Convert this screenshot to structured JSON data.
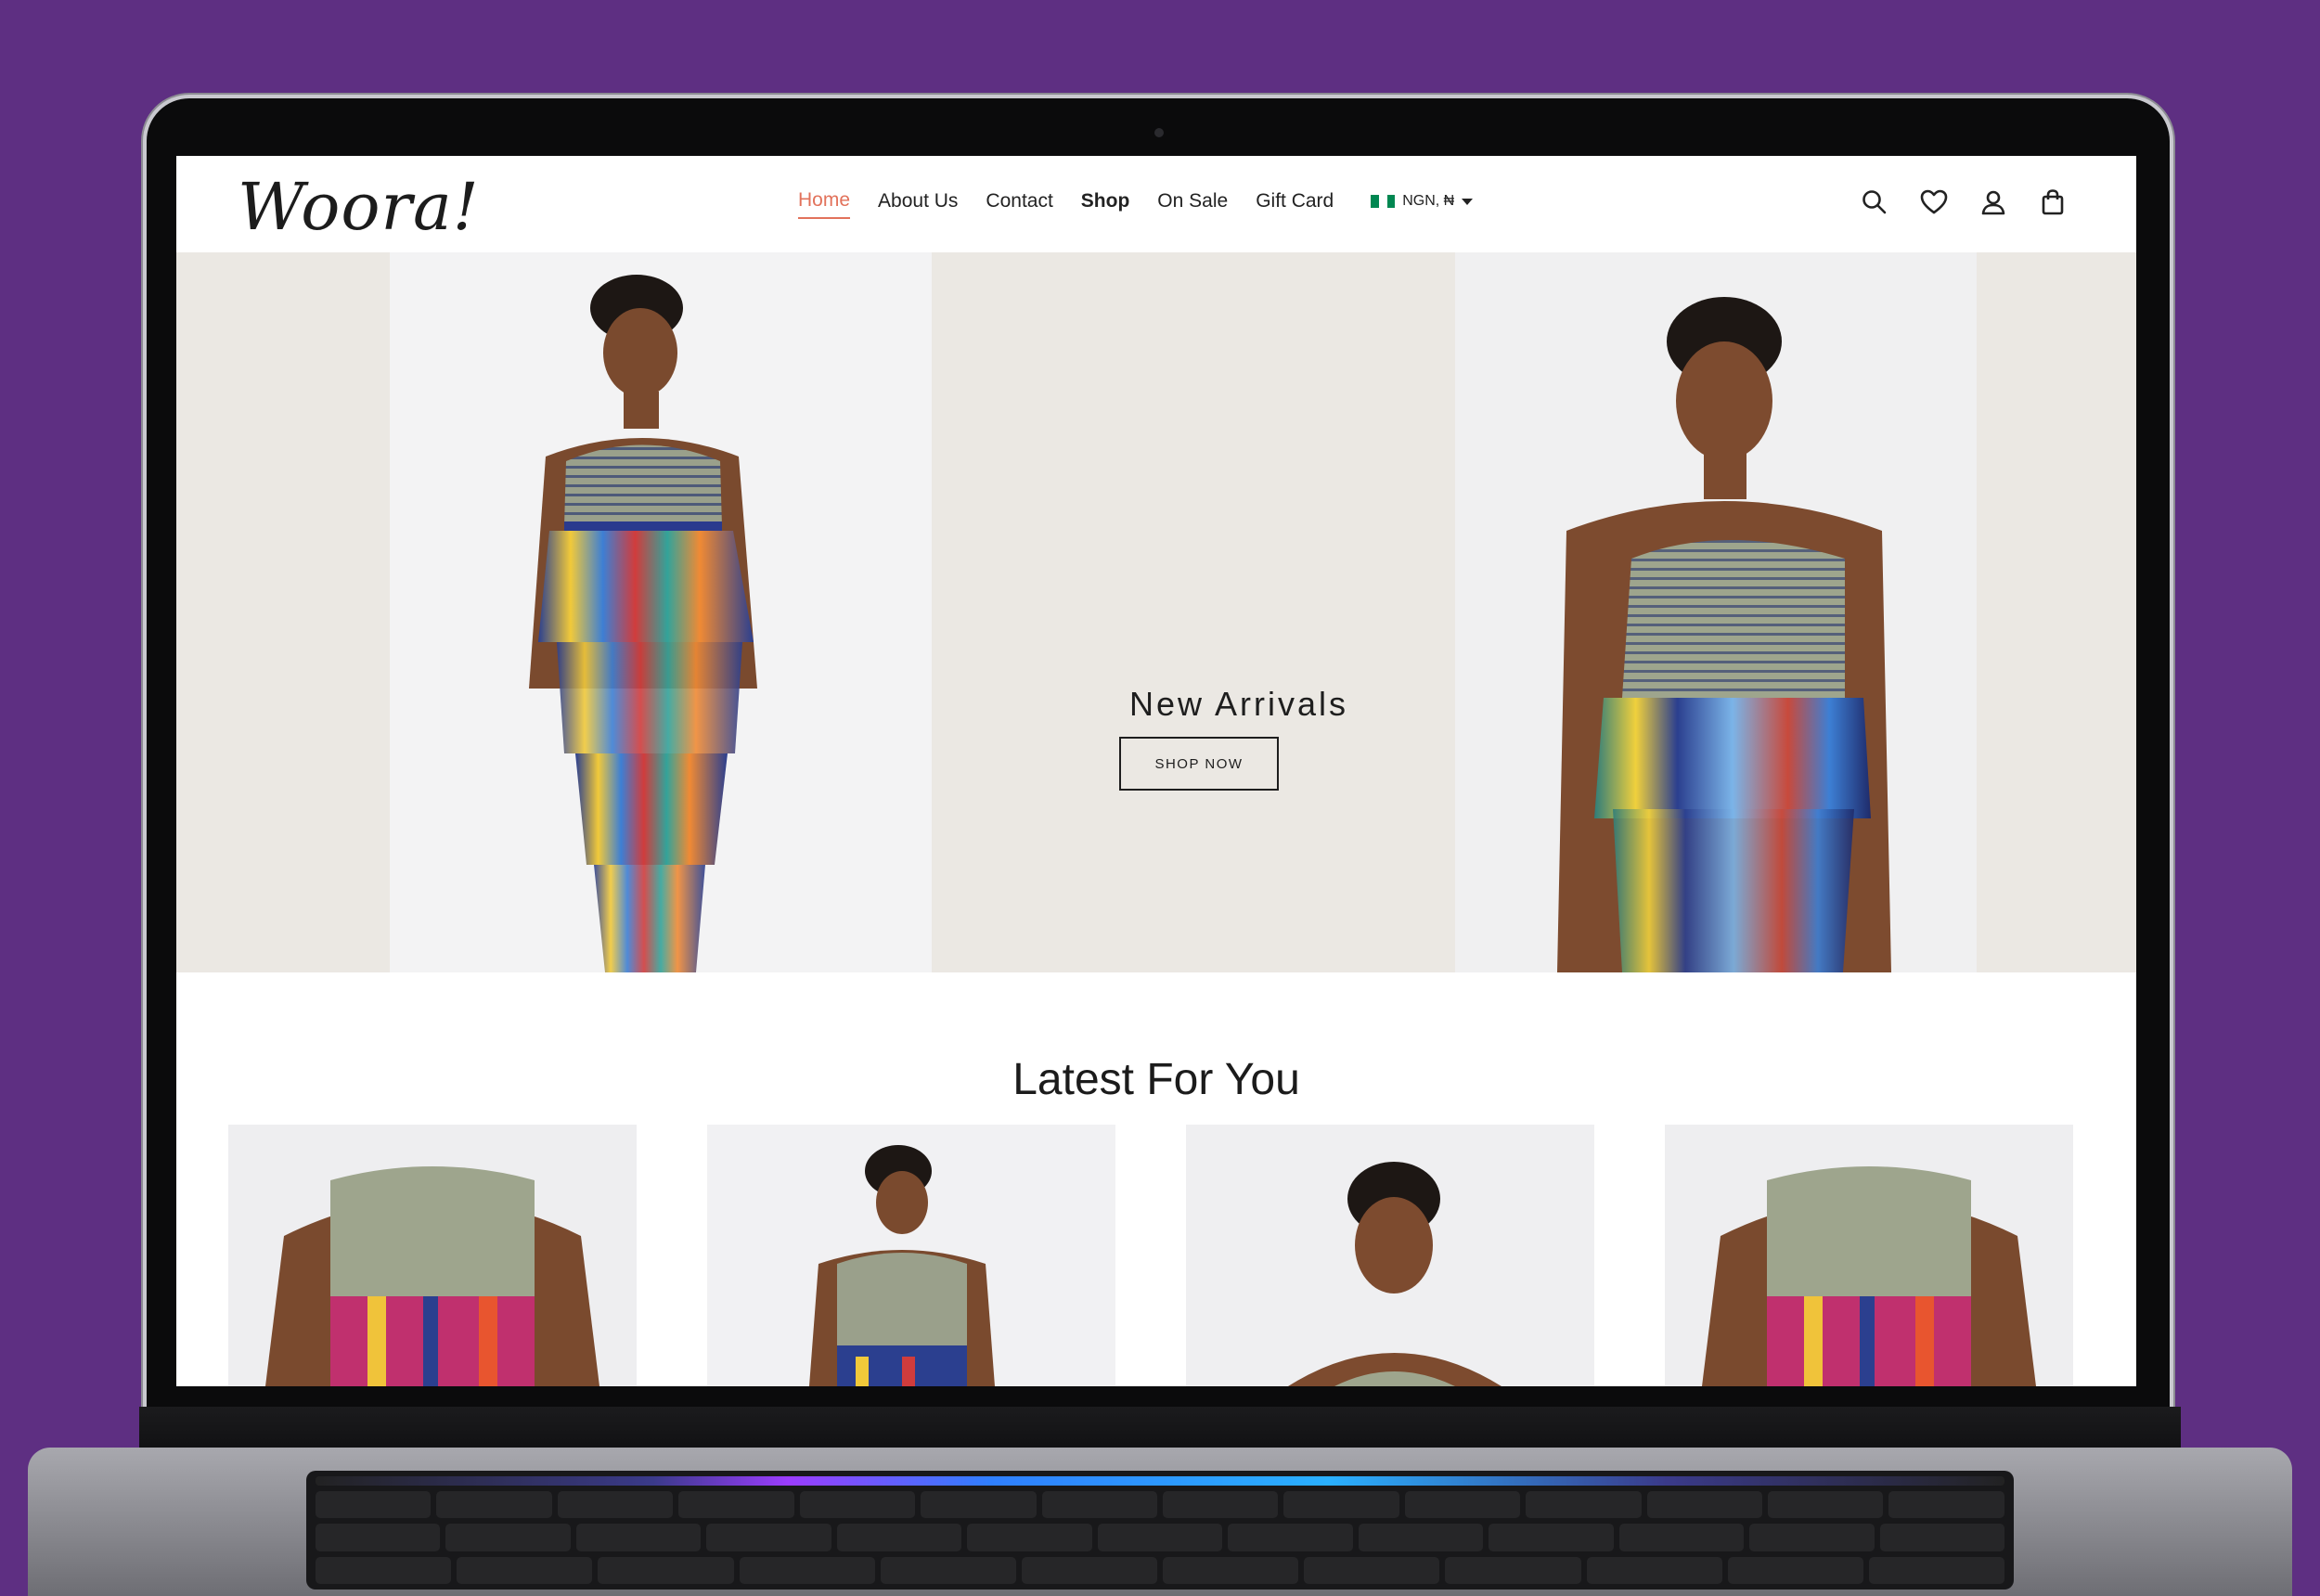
{
  "site": {
    "logo": "Woora!",
    "nav": [
      {
        "label": "Home",
        "active": true
      },
      {
        "label": "About Us"
      },
      {
        "label": "Contact"
      },
      {
        "label": "Shop",
        "bold": true
      },
      {
        "label": "On Sale"
      },
      {
        "label": "Gift Card"
      }
    ],
    "currency": "NGN, ₦",
    "icons": [
      "search-icon",
      "heart-icon",
      "user-icon",
      "bag-icon"
    ]
  },
  "hero": {
    "title": "New Arrivals",
    "button": "SHOP NOW"
  },
  "latest": {
    "title": "Latest For You"
  },
  "colors": {
    "accent": "#e2725b",
    "background": "#5e2f82",
    "hero_bg": "#ebe8e3"
  }
}
